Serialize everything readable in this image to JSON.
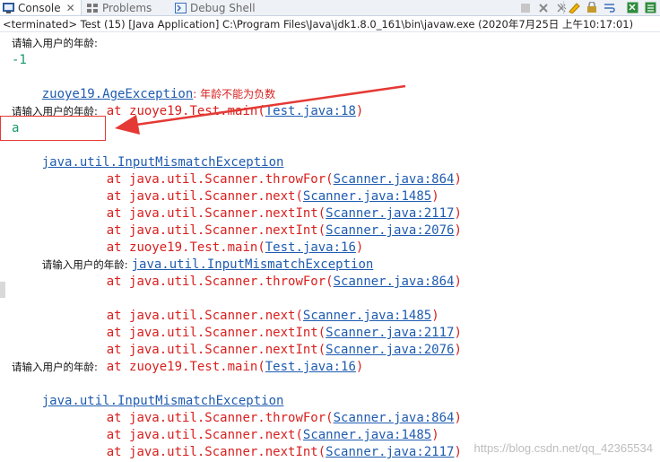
{
  "tabs": [
    {
      "label": "Console",
      "icon": "console-icon"
    },
    {
      "label": "Problems",
      "icon": "problems-icon"
    },
    {
      "label": "Debug Shell",
      "icon": "debug-shell-icon"
    }
  ],
  "status": "<terminated> Test (15) [Java Application] C:\\Program Files\\Java\\jdk1.8.0_161\\bin\\javaw.exe (2020年7月25日 上午10:17:01)",
  "prompt": "请输入用户的年龄:",
  "input1": "-1",
  "age_exception": "zuoye19.AgeException",
  "age_exception_msg": ": 年龄不能为负数",
  "at": "at ",
  "test_main": "zuoye19.Test.main",
  "test18": "Test.java:18",
  "input2": "a",
  "mismatch": "java.util.InputMismatchException",
  "throwFor": "java.util.Scanner.throwFor",
  "next": "java.util.Scanner.next",
  "nextInt": "java.util.Scanner.nextInt",
  "sc864": "Scanner.java:864",
  "sc1485": "Scanner.java:1485",
  "sc2117": "Scanner.java:2117",
  "sc2076": "Scanner.java:2076",
  "test16": "Test.java:16",
  "watermark": "https://blog.csdn.net/qq_42365534",
  "colors": {
    "error": "#d8201e",
    "link": "#1f5cb0",
    "input": "#1a9a6a",
    "annotation": "#e53935"
  }
}
